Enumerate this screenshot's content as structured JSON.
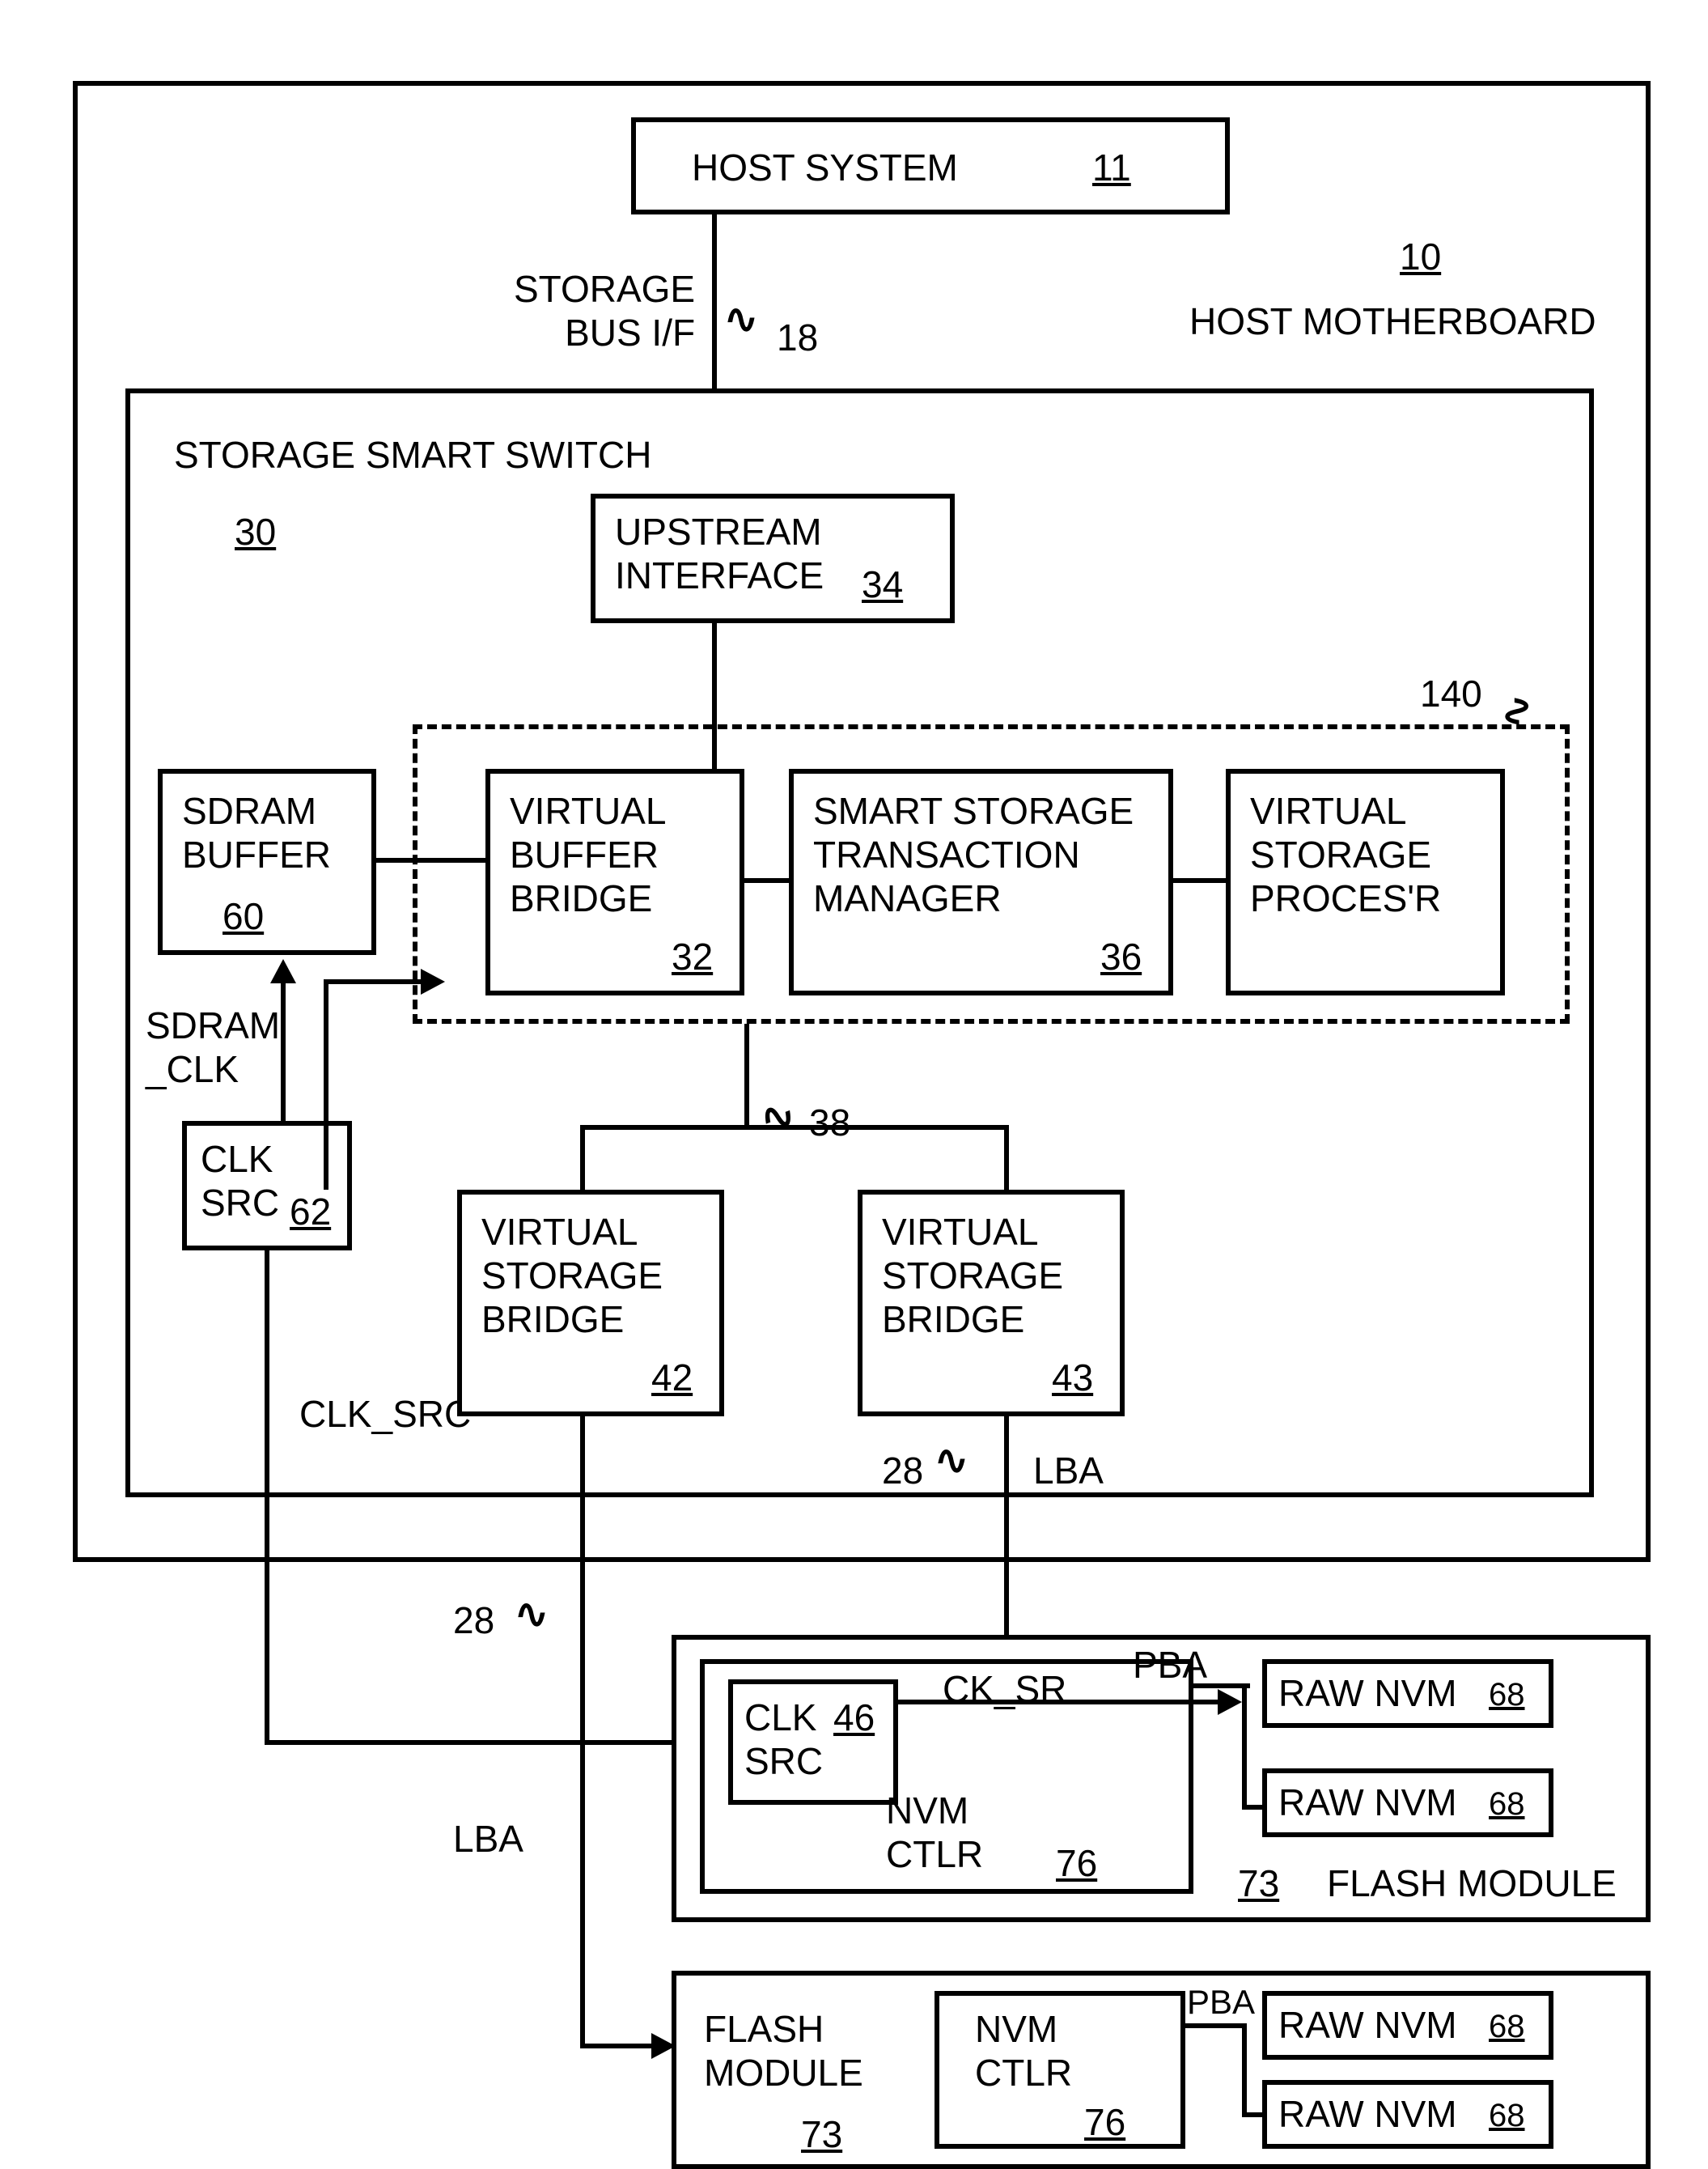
{
  "host_system": {
    "title": "HOST SYSTEM",
    "num": "11"
  },
  "host_motherboard": {
    "title": "HOST MOTHERBOARD",
    "num": "10"
  },
  "storage_bus": {
    "label": "STORAGE\nBUS I/F",
    "num": "18"
  },
  "switch": {
    "title": "STORAGE SMART SWITCH",
    "num": "30"
  },
  "upstream": {
    "title": "UPSTREAM\nINTERFACE",
    "num": "34"
  },
  "sdram_buffer": {
    "title": "SDRAM\nBUFFER",
    "num": "60"
  },
  "sdram_clk": "SDRAM\n_CLK",
  "clk_src_box": {
    "title": "CLK\nSRC",
    "num": "62"
  },
  "vbb": {
    "title": "VIRTUAL\nBUFFER\nBRIDGE",
    "num": "32"
  },
  "sstm": {
    "title": "SMART STORAGE\nTRANSACTION\nMANAGER",
    "num": "36"
  },
  "vsp": {
    "title": "VIRTUAL\nSTORAGE\nPROCES'R"
  },
  "group140": "140",
  "junction": "38",
  "vsb1": {
    "title": "VIRTUAL\nSTORAGE\nBRIDGE",
    "num": "42"
  },
  "vsb2": {
    "title": "VIRTUAL\nSTORAGE\nBRIDGE",
    "num": "43"
  },
  "clk_src_label": "CLK_SRC",
  "lba": "LBA",
  "wire28a": "28",
  "wire28b": "28",
  "fm1": {
    "clk_src": {
      "title": "CLK\nSRC",
      "num": "46"
    },
    "ck_sr": "CK_SR",
    "nvm_ctlr": {
      "title": "NVM\nCTLR",
      "num": "76"
    },
    "pba": "PBA",
    "raw1": {
      "title": "RAW NVM",
      "num": "68"
    },
    "raw2": {
      "title": "RAW NVM",
      "num": "68"
    },
    "module": {
      "title": "FLASH MODULE",
      "num": "73"
    }
  },
  "fm2": {
    "title": "FLASH\nMODULE",
    "num": "73",
    "nvm_ctlr": {
      "title": "NVM\nCTLR",
      "num": "76"
    },
    "pba": "PBA",
    "raw1": {
      "title": "RAW NVM",
      "num": "68"
    },
    "raw2": {
      "title": "RAW NVM",
      "num": "68"
    }
  }
}
